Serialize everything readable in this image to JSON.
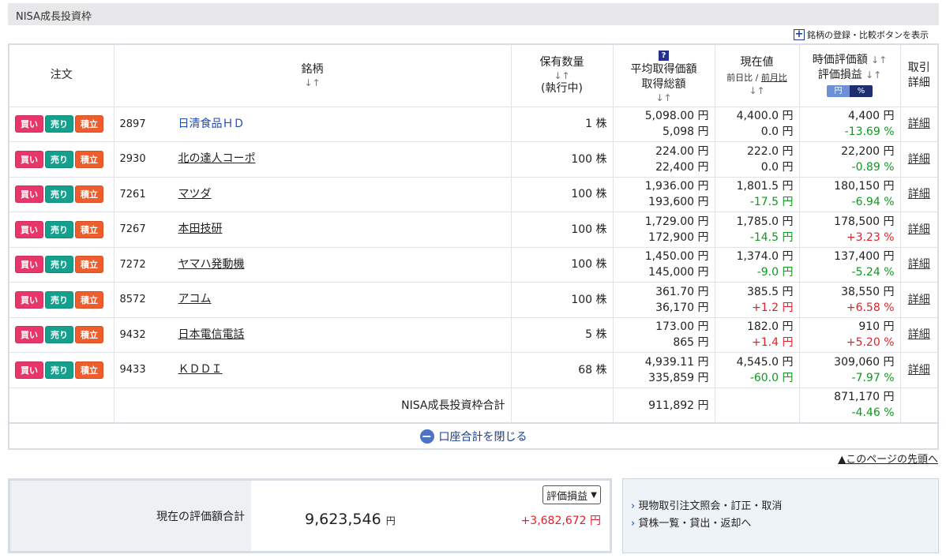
{
  "section_title": "NISA成長投資枠",
  "register_link": "銘柄の登録・比較ボタンを表示",
  "headers": {
    "order": "注文",
    "name": "銘柄",
    "qty": "保有数量",
    "qty_sub": "(執行中)",
    "avg_price": "平均取得価額",
    "total_cost": "取得総額",
    "current": "現在値",
    "day_change": "前日比",
    "month_change": "前月比",
    "market_value": "時価評価額",
    "pl": "評価損益",
    "toggle_yen": "円",
    "toggle_pct": "%",
    "detail": "取引詳細",
    "sort_arrow": "↓↑"
  },
  "buttons": {
    "buy": "買い",
    "sell": "売り",
    "accum": "積立"
  },
  "rows": [
    {
      "code": "2897",
      "name": "日清食品ＨＤ",
      "qty": "1 株",
      "avg": "5,098.00 円",
      "cost": "5,098 円",
      "price": "4,400.0 円",
      "chg": "0.0 円",
      "value": "4,400 円",
      "pl": "-13.69 %",
      "detail": "詳細"
    },
    {
      "code": "2930",
      "name": "北の達人コーポ",
      "qty": "100 株",
      "avg": "224.00 円",
      "cost": "22,400 円",
      "price": "222.0 円",
      "chg": "0.0 円",
      "value": "22,200 円",
      "pl": "-0.89 %",
      "detail": "詳細"
    },
    {
      "code": "7261",
      "name": "マツダ",
      "qty": "100 株",
      "avg": "1,936.00 円",
      "cost": "193,600 円",
      "price": "1,801.5 円",
      "chg": "-17.5 円",
      "value": "180,150 円",
      "pl": "-6.94 %",
      "detail": "詳細"
    },
    {
      "code": "7267",
      "name": "本田技研",
      "qty": "100 株",
      "avg": "1,729.00 円",
      "cost": "172,900 円",
      "price": "1,785.0 円",
      "chg": "-14.5 円",
      "value": "178,500 円",
      "pl": "+3.23 %",
      "detail": "詳細"
    },
    {
      "code": "7272",
      "name": "ヤマハ発動機",
      "qty": "100 株",
      "avg": "1,450.00 円",
      "cost": "145,000 円",
      "price": "1,374.0 円",
      "chg": "-9.0 円",
      "value": "137,400 円",
      "pl": "-5.24 %",
      "detail": "詳細"
    },
    {
      "code": "8572",
      "name": "アコム",
      "qty": "100 株",
      "avg": "361.70 円",
      "cost": "36,170 円",
      "price": "385.5 円",
      "chg": "+1.2 円",
      "value": "38,550 円",
      "pl": "+6.58 %",
      "detail": "詳細"
    },
    {
      "code": "9432",
      "name": "日本電信電話",
      "qty": "5 株",
      "avg": "173.00 円",
      "cost": "865 円",
      "price": "182.0 円",
      "chg": "+1.4 円",
      "value": "910 円",
      "pl": "+5.20 %",
      "detail": "詳細"
    },
    {
      "code": "9433",
      "name": "ＫＤＤＩ",
      "qty": "68 株",
      "avg": "4,939.11 円",
      "cost": "335,859 円",
      "price": "4,545.0 円",
      "chg": "-60.0 円",
      "value": "309,060 円",
      "pl": "-7.97 %",
      "detail": "詳細"
    }
  ],
  "total": {
    "label": "NISA成長投資枠合計",
    "cost": "911,892 円",
    "value": "871,170 円",
    "pl": "-4.46 %"
  },
  "close_label": "口座合計を閉じる",
  "page_top": "▲このページの先頭へ",
  "summary": {
    "label": "現在の評価額合計",
    "value": "9,623,546",
    "unit": "円",
    "select_value": "評価損益",
    "pl": "+3,682,672 円"
  },
  "links": [
    "現物取引注文照会・訂正・取消",
    "貸株一覧・貸出・返却へ"
  ],
  "colors": {
    "buy": "#e8366a",
    "sell": "#14a08c",
    "accum": "#ee5d2b",
    "negative": "#0d9a1f",
    "positive": "#e0202a"
  }
}
